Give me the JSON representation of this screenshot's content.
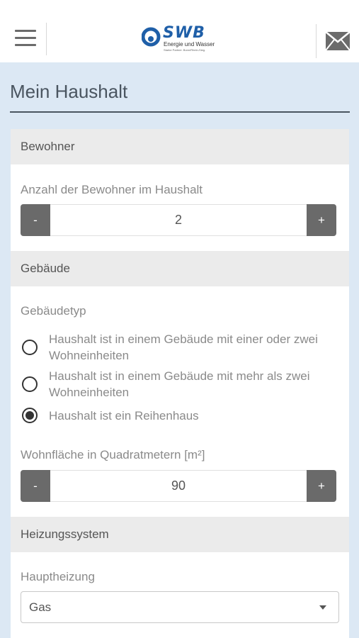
{
  "header": {
    "brand": "SWB",
    "tagline": "Energie und Wasser",
    "subtagline": "Starke Partner. Bonn/Rhein-Sieg.",
    "brand_color": "#1f5fa8",
    "menu_icon": "hamburger-icon",
    "mail_icon": "mail-icon"
  },
  "page": {
    "title": "Mein Haushalt"
  },
  "bewohner": {
    "section_title": "Bewohner",
    "label": "Anzahl der Bewohner im Haushalt",
    "minus_label": "-",
    "plus_label": "+",
    "value": "2"
  },
  "gebaeude": {
    "section_title": "Gebäude",
    "type_label": "Gebäudetyp",
    "options": [
      {
        "label": "Haushalt ist in einem Gebäude mit einer oder zwei Wohneinheiten",
        "checked": false
      },
      {
        "label": "Haushalt ist in einem Gebäude mit mehr als zwei Wohneinheiten",
        "checked": false
      },
      {
        "label": "Haushalt ist ein Reihenhaus",
        "checked": true
      }
    ],
    "area_label": "Wohnfläche in Quadratmetern [m²]",
    "area_minus": "-",
    "area_plus": "+",
    "area_value": "90"
  },
  "heizung": {
    "section_title": "Heizungssystem",
    "label": "Hauptheizung",
    "selected": "Gas"
  }
}
